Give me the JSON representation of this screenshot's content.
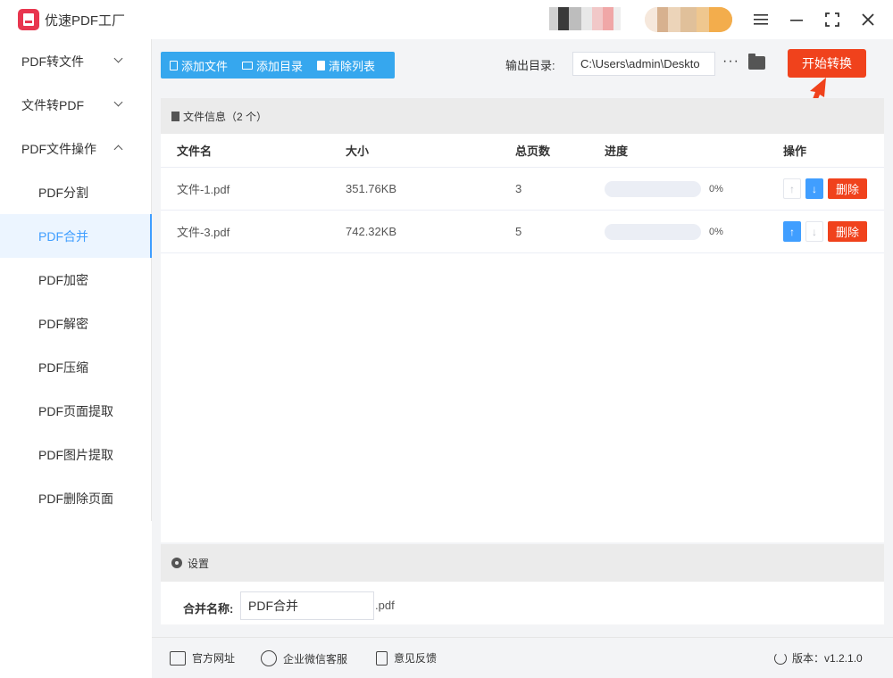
{
  "app": {
    "title": "优速PDF工厂"
  },
  "window": {
    "menu_icon": "hamburger-icon",
    "minimize_icon": "minimize-icon",
    "maximize_icon": "maximize-icon",
    "close_icon": "close-icon"
  },
  "sidebar": {
    "groups": [
      {
        "label": "PDF转文件",
        "expanded": false
      },
      {
        "label": "文件转PDF",
        "expanded": false
      },
      {
        "label": "PDF文件操作",
        "expanded": true
      }
    ],
    "items": [
      {
        "label": "PDF分割",
        "active": false
      },
      {
        "label": "PDF合并",
        "active": true
      },
      {
        "label": "PDF加密",
        "active": false
      },
      {
        "label": "PDF解密",
        "active": false
      },
      {
        "label": "PDF压缩",
        "active": false
      },
      {
        "label": "PDF页面提取",
        "active": false
      },
      {
        "label": "PDF图片提取",
        "active": false
      },
      {
        "label": "PDF删除页面",
        "active": false
      }
    ]
  },
  "toolbar": {
    "add_file": "添加文件",
    "add_folder": "添加目录",
    "clear_list": "清除列表",
    "output_label": "输出目录:",
    "output_path": "C:\\Users\\admin\\Deskto",
    "more": "···",
    "start": "开始转换"
  },
  "files": {
    "header": "文件信息（2 个）",
    "columns": [
      "文件名",
      "大小",
      "总页数",
      "进度",
      "操作"
    ],
    "rows": [
      {
        "name": "文件-1.pdf",
        "size": "351.76KB",
        "pages": "3",
        "progress": "0%",
        "progress_value": 0,
        "up_enabled": false,
        "down_enabled": true,
        "delete": "删除"
      },
      {
        "name": "文件-3.pdf",
        "size": "742.32KB",
        "pages": "5",
        "progress": "0%",
        "progress_value": 0,
        "up_enabled": true,
        "down_enabled": false,
        "delete": "删除"
      }
    ]
  },
  "settings": {
    "header": "设置",
    "merge_label": "合并名称:",
    "merge_value": "PDF合并",
    "suffix": ".pdf"
  },
  "footer": {
    "website": "官方网址",
    "wechat": "企业微信客服",
    "feedback": "意见反馈",
    "version": "版本：v1.2.1.0"
  },
  "colors": {
    "accent": "#409eff",
    "toolbar": "#36a7ee",
    "danger": "#f0421c"
  }
}
